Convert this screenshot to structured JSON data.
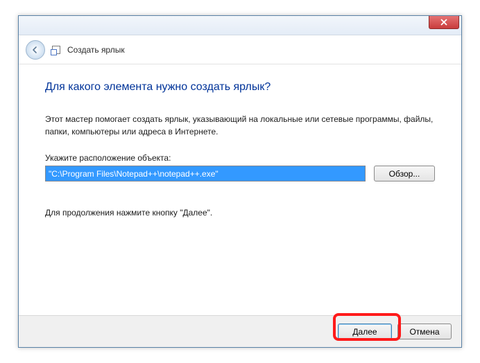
{
  "header": {
    "title": "Создать ярлык"
  },
  "page": {
    "title": "Для какого элемента нужно создать ярлык?",
    "description": "Этот мастер помогает создать ярлык, указывающий на локальные или сетевые программы, файлы, папки, компьютеры или адреса в Интернете.",
    "location_label": "Укажите расположение объекта:",
    "location_value": "\"C:\\Program Files\\Notepad++\\notepad++.exe\"",
    "continue_hint": "Для продолжения нажмите кнопку \"Далее\"."
  },
  "buttons": {
    "browse": "Обзор...",
    "next": "Далее",
    "cancel": "Отмена"
  }
}
